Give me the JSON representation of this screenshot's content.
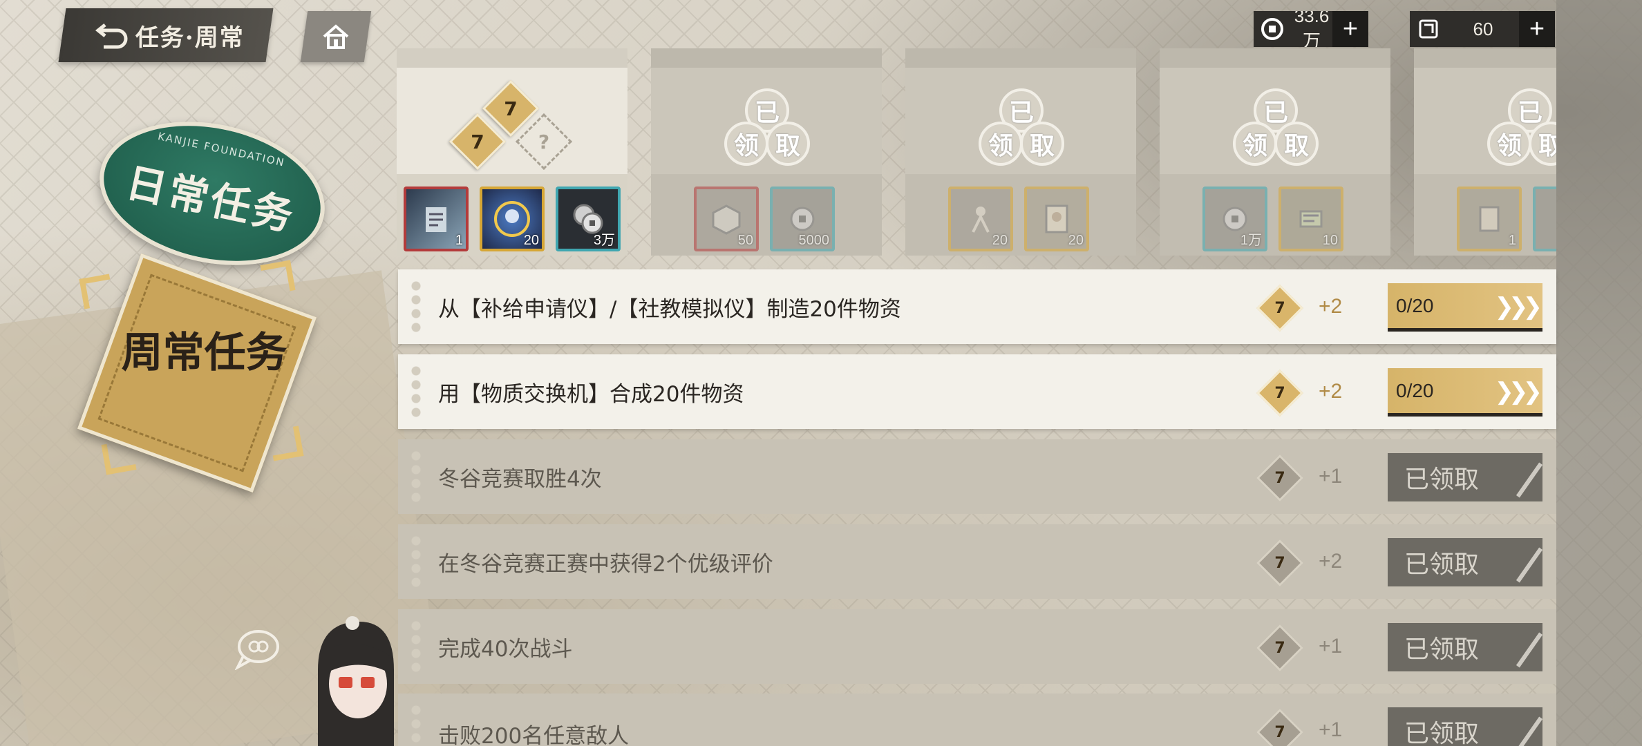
{
  "header": {
    "title": "任务·周常"
  },
  "currencies": [
    {
      "icon": "coin-icon",
      "value": "33.6万"
    },
    {
      "icon": "ticket-icon",
      "value": "60"
    }
  ],
  "badges": {
    "daily_label": "日常任务",
    "daily_sub": "KANJIE FOUNDATION",
    "weekly_label": "周常任务"
  },
  "reward_tiers": [
    {
      "status": "available",
      "items": [
        {
          "qty": "1"
        },
        {
          "qty": "20"
        },
        {
          "qty": "3万"
        }
      ]
    },
    {
      "status": "claimed",
      "claimed_text": [
        "已",
        "领",
        "取"
      ],
      "items": [
        {
          "qty": "50"
        },
        {
          "qty": "5000"
        }
      ]
    },
    {
      "status": "claimed",
      "claimed_text": [
        "已",
        "领",
        "取"
      ],
      "items": [
        {
          "qty": "20"
        },
        {
          "qty": "20"
        }
      ]
    },
    {
      "status": "claimed",
      "claimed_text": [
        "已",
        "领",
        "取"
      ],
      "items": [
        {
          "qty": "1万"
        },
        {
          "qty": "10"
        }
      ]
    },
    {
      "status": "claimed",
      "claimed_text": [
        "已",
        "领",
        "取"
      ],
      "items": [
        {
          "qty": "1"
        }
      ]
    }
  ],
  "tasks": [
    {
      "label": "从【补给申请仪】/【社教模拟仪】制造20件物资",
      "points": "+2",
      "progress": "0/20",
      "status": "active"
    },
    {
      "label": "用【物质交换机】合成20件物资",
      "points": "+2",
      "progress": "0/20",
      "status": "active"
    },
    {
      "label": "冬谷竞赛取胜4次",
      "points": "+1",
      "button": "已领取",
      "status": "done"
    },
    {
      "label": "在冬谷竞赛正赛中获得2个优级评价",
      "points": "+2",
      "button": "已领取",
      "status": "done"
    },
    {
      "label": "完成40次战斗",
      "points": "+1",
      "button": "已领取",
      "status": "done"
    },
    {
      "label": "击败200名任意敌人",
      "points": "+1",
      "button": "已领取",
      "status": "done"
    }
  ],
  "colors": {
    "accent_gold": "#d6b469",
    "claimed_gray": "#6d6a63",
    "daily_green": "#1d5a48"
  }
}
